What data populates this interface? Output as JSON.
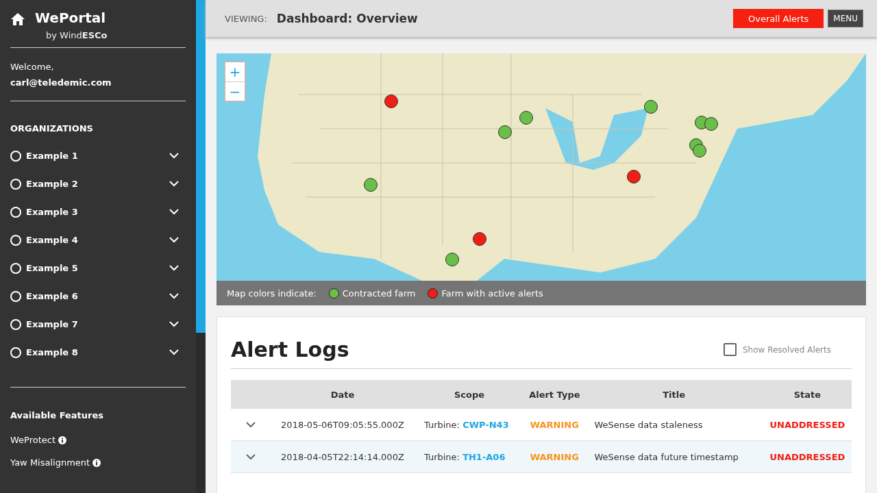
{
  "brand": {
    "title": "WePortal",
    "subtitle_prefix": "by Wind",
    "subtitle_bold": "ESCo"
  },
  "user": {
    "greeting": "Welcome,",
    "email": "carl@teledemic.com"
  },
  "organizations": {
    "heading": "ORGANIZATIONS",
    "items": [
      {
        "label": "Example 1",
        "selected": false
      },
      {
        "label": "Example 2",
        "selected": false
      },
      {
        "label": "Example 3",
        "selected": false
      },
      {
        "label": "Example 4",
        "selected": false
      },
      {
        "label": "Example 5",
        "selected": false
      },
      {
        "label": "Example 6",
        "selected": false
      },
      {
        "label": "Example 7",
        "selected": false
      },
      {
        "label": "Example 8",
        "selected": false
      }
    ]
  },
  "features": {
    "heading": "Available Features",
    "items": [
      "WeProtect",
      "Yaw Misalignment"
    ]
  },
  "header": {
    "viewing_label": "VIEWING:",
    "page_title": "Dashboard: Overview",
    "alerts_button": "Overall Alerts",
    "menu_button": "MENU"
  },
  "map": {
    "zoom_in": "+",
    "zoom_out": "−",
    "markers": [
      {
        "color": "#f01e14"
      },
      {
        "color": "#6abf4b"
      },
      {
        "color": "#6abf4b"
      },
      {
        "color": "#6abf4b"
      },
      {
        "color": "#6abf4b"
      },
      {
        "color": "#6abf4b"
      },
      {
        "color": "#6abf4b"
      },
      {
        "color": "#6abf4b"
      },
      {
        "color": "#6abf4b"
      },
      {
        "color": "#f01e14"
      },
      {
        "color": "#f01e14"
      },
      {
        "color": "#6abf4b"
      }
    ],
    "legend": {
      "label": "Map colors indicate:",
      "items": [
        {
          "label": "Contracted farm",
          "color": "#6abf4b"
        },
        {
          "label": "Farm with active alerts",
          "color": "#f01e14"
        }
      ]
    }
  },
  "alert_logs": {
    "title": "Alert Logs",
    "show_resolved": {
      "label": "Show Resolved Alerts",
      "checked": false
    },
    "columns": [
      "Date",
      "Scope",
      "Alert Type",
      "Title",
      "State"
    ],
    "rows": [
      {
        "date": "2018-05-06T09:05:55.000Z",
        "scope_label": "Turbine:",
        "scope_id": "CWP-N43",
        "alert_type": "WARNING",
        "title": "WeSense data staleness",
        "state": "UNADDRESSED",
        "selected": false
      },
      {
        "date": "2018-04-05T22:14:14.000Z",
        "scope_label": "Turbine:",
        "scope_id": "TH1-A06",
        "alert_type": "WARNING",
        "title": "WeSense data future timestamp",
        "state": "UNADDRESSED",
        "selected": true
      }
    ]
  }
}
